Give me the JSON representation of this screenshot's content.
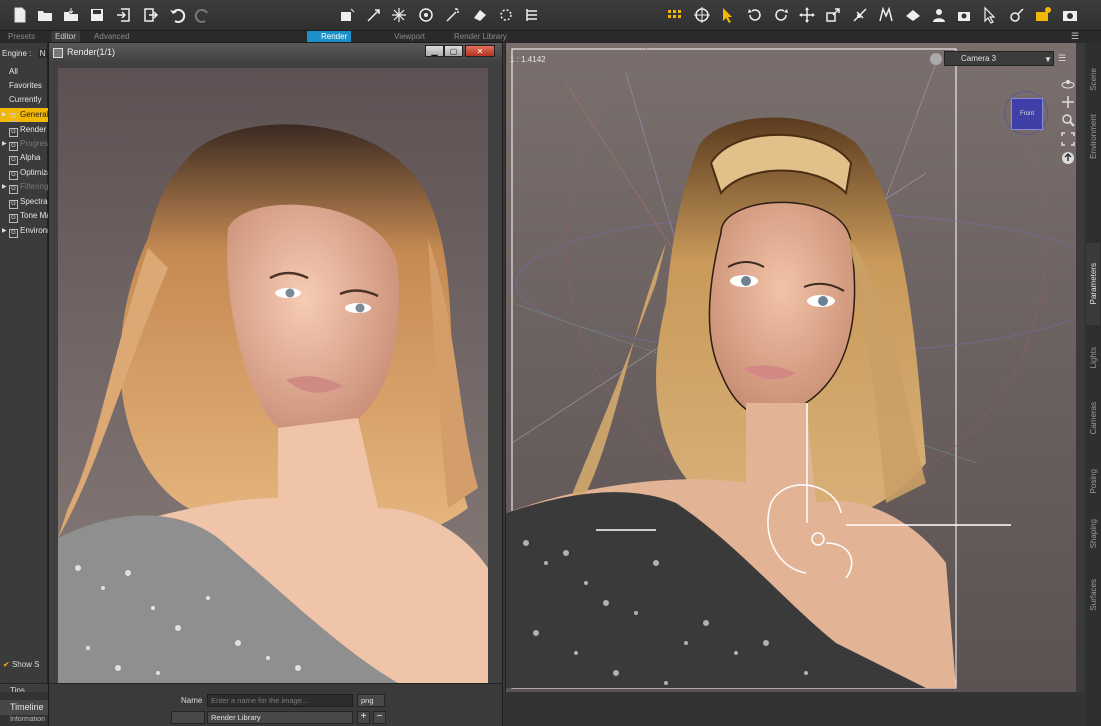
{
  "toolbar": {
    "left_icons": [
      "new-file-icon",
      "open-icon",
      "merge-icon",
      "save-icon",
      "import-icon",
      "export-icon",
      "undo-icon",
      "redo-icon"
    ],
    "middle_icons": [
      "render-settings-icon",
      "render-icon",
      "iray-preview-icon",
      "spot-render-icon",
      "shader-icon",
      "mesh-icon",
      "lasso-icon",
      "bars-icon"
    ],
    "right_icons": [
      "grid-icon",
      "universal-tool-icon",
      "pointer-icon",
      "rotate-icon",
      "twist-icon",
      "translate-icon",
      "scale-icon",
      "joint-editor-icon",
      "node-weight-icon",
      "surface-selection-icon",
      "geometry-editor-icon",
      "figure-icon",
      "camera-add-icon",
      "pose-tool-icon",
      "region-nav-icon",
      "active-pose-icon",
      "render-camera-icon"
    ],
    "accent": "#f2b705"
  },
  "tabs": {
    "presets": "Presets",
    "editor": "Editor",
    "advanced": "Advanced",
    "render": "Render",
    "viewport": "Viewport",
    "render_library": "Render Library"
  },
  "left_pane": {
    "engine_label": "Engine :",
    "engine_value": "N",
    "items": [
      "All",
      "Favorites",
      "Currently"
    ],
    "sections": [
      {
        "label": "General",
        "expandable": true,
        "highlight": true
      },
      {
        "label": "Render",
        "expandable": false,
        "highlight": false
      },
      {
        "label": "Progressive",
        "expandable": true,
        "highlight": false,
        "dim": true
      },
      {
        "label": "Alpha",
        "expandable": false,
        "highlight": false
      },
      {
        "label": "Optimization",
        "expandable": false,
        "highlight": false
      },
      {
        "label": "Filtering",
        "expandable": true,
        "highlight": false,
        "dim": true
      },
      {
        "label": "Spectral",
        "expandable": false,
        "highlight": false
      },
      {
        "label": "Tone Mapping",
        "expandable": false,
        "highlight": false
      },
      {
        "label": "Environment",
        "expandable": true,
        "highlight": false
      }
    ],
    "show_sub": "Show S",
    "tips": "Tips",
    "timeline": "Timeline",
    "information": "Information"
  },
  "render_window": {
    "title": "Render(1/1)",
    "name_label": "Name",
    "name_placeholder": "Enter a name for the image...",
    "format": "png",
    "destination": "Render Library",
    "plus": "+",
    "minus": "−"
  },
  "viewport": {
    "aspect_ratio": "1 : 1.4142",
    "camera": "Camera 3",
    "nav_cube_face": "Front"
  },
  "right_tabs": [
    "Scene",
    "Environment",
    "Parameters",
    "Lights",
    "Cameras",
    "Posing",
    "Shaping",
    "Surfaces"
  ],
  "active_right_tab": "Parameters"
}
